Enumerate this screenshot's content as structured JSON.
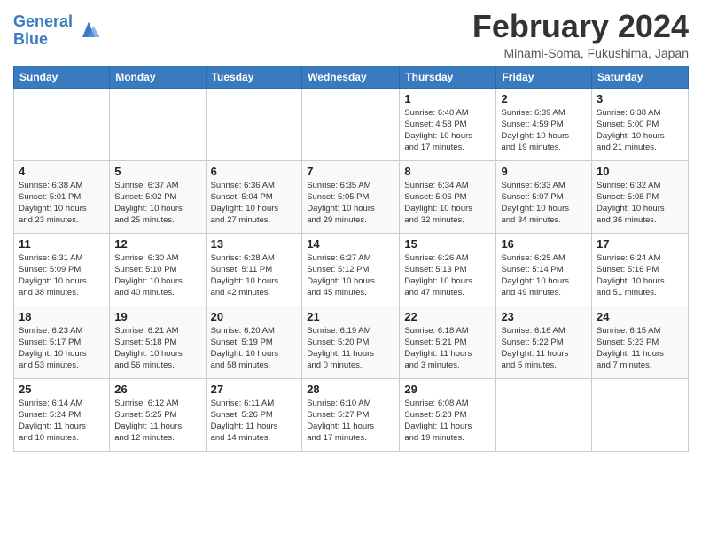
{
  "logo": {
    "line1": "General",
    "line2": "Blue"
  },
  "title": "February 2024",
  "subtitle": "Minami-Soma, Fukushima, Japan",
  "days_of_week": [
    "Sunday",
    "Monday",
    "Tuesday",
    "Wednesday",
    "Thursday",
    "Friday",
    "Saturday"
  ],
  "weeks": [
    [
      {
        "day": "",
        "info": ""
      },
      {
        "day": "",
        "info": ""
      },
      {
        "day": "",
        "info": ""
      },
      {
        "day": "",
        "info": ""
      },
      {
        "day": "1",
        "info": "Sunrise: 6:40 AM\nSunset: 4:58 PM\nDaylight: 10 hours\nand 17 minutes."
      },
      {
        "day": "2",
        "info": "Sunrise: 6:39 AM\nSunset: 4:59 PM\nDaylight: 10 hours\nand 19 minutes."
      },
      {
        "day": "3",
        "info": "Sunrise: 6:38 AM\nSunset: 5:00 PM\nDaylight: 10 hours\nand 21 minutes."
      }
    ],
    [
      {
        "day": "4",
        "info": "Sunrise: 6:38 AM\nSunset: 5:01 PM\nDaylight: 10 hours\nand 23 minutes."
      },
      {
        "day": "5",
        "info": "Sunrise: 6:37 AM\nSunset: 5:02 PM\nDaylight: 10 hours\nand 25 minutes."
      },
      {
        "day": "6",
        "info": "Sunrise: 6:36 AM\nSunset: 5:04 PM\nDaylight: 10 hours\nand 27 minutes."
      },
      {
        "day": "7",
        "info": "Sunrise: 6:35 AM\nSunset: 5:05 PM\nDaylight: 10 hours\nand 29 minutes."
      },
      {
        "day": "8",
        "info": "Sunrise: 6:34 AM\nSunset: 5:06 PM\nDaylight: 10 hours\nand 32 minutes."
      },
      {
        "day": "9",
        "info": "Sunrise: 6:33 AM\nSunset: 5:07 PM\nDaylight: 10 hours\nand 34 minutes."
      },
      {
        "day": "10",
        "info": "Sunrise: 6:32 AM\nSunset: 5:08 PM\nDaylight: 10 hours\nand 36 minutes."
      }
    ],
    [
      {
        "day": "11",
        "info": "Sunrise: 6:31 AM\nSunset: 5:09 PM\nDaylight: 10 hours\nand 38 minutes."
      },
      {
        "day": "12",
        "info": "Sunrise: 6:30 AM\nSunset: 5:10 PM\nDaylight: 10 hours\nand 40 minutes."
      },
      {
        "day": "13",
        "info": "Sunrise: 6:28 AM\nSunset: 5:11 PM\nDaylight: 10 hours\nand 42 minutes."
      },
      {
        "day": "14",
        "info": "Sunrise: 6:27 AM\nSunset: 5:12 PM\nDaylight: 10 hours\nand 45 minutes."
      },
      {
        "day": "15",
        "info": "Sunrise: 6:26 AM\nSunset: 5:13 PM\nDaylight: 10 hours\nand 47 minutes."
      },
      {
        "day": "16",
        "info": "Sunrise: 6:25 AM\nSunset: 5:14 PM\nDaylight: 10 hours\nand 49 minutes."
      },
      {
        "day": "17",
        "info": "Sunrise: 6:24 AM\nSunset: 5:16 PM\nDaylight: 10 hours\nand 51 minutes."
      }
    ],
    [
      {
        "day": "18",
        "info": "Sunrise: 6:23 AM\nSunset: 5:17 PM\nDaylight: 10 hours\nand 53 minutes."
      },
      {
        "day": "19",
        "info": "Sunrise: 6:21 AM\nSunset: 5:18 PM\nDaylight: 10 hours\nand 56 minutes."
      },
      {
        "day": "20",
        "info": "Sunrise: 6:20 AM\nSunset: 5:19 PM\nDaylight: 10 hours\nand 58 minutes."
      },
      {
        "day": "21",
        "info": "Sunrise: 6:19 AM\nSunset: 5:20 PM\nDaylight: 11 hours\nand 0 minutes."
      },
      {
        "day": "22",
        "info": "Sunrise: 6:18 AM\nSunset: 5:21 PM\nDaylight: 11 hours\nand 3 minutes."
      },
      {
        "day": "23",
        "info": "Sunrise: 6:16 AM\nSunset: 5:22 PM\nDaylight: 11 hours\nand 5 minutes."
      },
      {
        "day": "24",
        "info": "Sunrise: 6:15 AM\nSunset: 5:23 PM\nDaylight: 11 hours\nand 7 minutes."
      }
    ],
    [
      {
        "day": "25",
        "info": "Sunrise: 6:14 AM\nSunset: 5:24 PM\nDaylight: 11 hours\nand 10 minutes."
      },
      {
        "day": "26",
        "info": "Sunrise: 6:12 AM\nSunset: 5:25 PM\nDaylight: 11 hours\nand 12 minutes."
      },
      {
        "day": "27",
        "info": "Sunrise: 6:11 AM\nSunset: 5:26 PM\nDaylight: 11 hours\nand 14 minutes."
      },
      {
        "day": "28",
        "info": "Sunrise: 6:10 AM\nSunset: 5:27 PM\nDaylight: 11 hours\nand 17 minutes."
      },
      {
        "day": "29",
        "info": "Sunrise: 6:08 AM\nSunset: 5:28 PM\nDaylight: 11 hours\nand 19 minutes."
      },
      {
        "day": "",
        "info": ""
      },
      {
        "day": "",
        "info": ""
      }
    ]
  ]
}
